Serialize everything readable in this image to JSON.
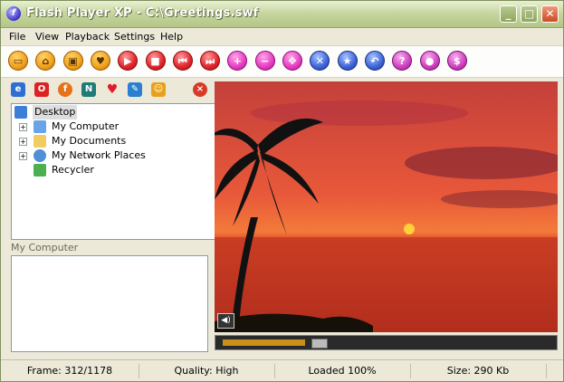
{
  "window": {
    "title": "Flash Player XP - C:\\Greetings.swf",
    "controls": {
      "minimize": "_",
      "maximize": "□",
      "close": "✕"
    }
  },
  "menu": [
    "File",
    "View",
    "Playback",
    "Settings",
    "Help"
  ],
  "toolbar": [
    {
      "name": "open-folder-icon",
      "glyph": "▭",
      "color": "orange"
    },
    {
      "name": "home-icon",
      "glyph": "⌂",
      "color": "orange"
    },
    {
      "name": "save-disk-icon",
      "glyph": "▣",
      "color": "orange"
    },
    {
      "name": "favorite-heart-icon",
      "glyph": "♥",
      "color": "orange"
    },
    {
      "name": "play-icon",
      "glyph": "▶",
      "color": "red"
    },
    {
      "name": "stop-icon",
      "glyph": "■",
      "color": "red"
    },
    {
      "name": "previous-frame-icon",
      "glyph": "⏮",
      "color": "red"
    },
    {
      "name": "next-frame-icon",
      "glyph": "⏭",
      "color": "red"
    },
    {
      "name": "zoom-in-icon",
      "glyph": "+",
      "color": "pink"
    },
    {
      "name": "zoom-out-icon",
      "glyph": "−",
      "color": "pink"
    },
    {
      "name": "fit-icon",
      "glyph": "✥",
      "color": "pink"
    },
    {
      "name": "tools-icon",
      "glyph": "✕",
      "color": "blue"
    },
    {
      "name": "star-icon",
      "glyph": "★",
      "color": "blue"
    },
    {
      "name": "back-arrow-icon",
      "glyph": "↶",
      "color": "blue"
    },
    {
      "name": "help-icon",
      "glyph": "?",
      "color": "magenta"
    },
    {
      "name": "user-icon",
      "glyph": "●",
      "color": "magenta"
    },
    {
      "name": "money-icon",
      "glyph": "$",
      "color": "magenta"
    }
  ],
  "sidebar": {
    "icons": [
      "internet-explorer-icon",
      "opera-icon",
      "firefox-icon",
      "netscape-icon",
      "favorites-heart-icon",
      "edit-icon",
      "swf-icon"
    ],
    "tree": [
      {
        "label": "Desktop",
        "level": 0,
        "icon": "desktop-icon"
      },
      {
        "label": "My Computer",
        "level": 1,
        "icon": "computer-icon",
        "expander": "+"
      },
      {
        "label": "My Documents",
        "level": 1,
        "icon": "documents-folder-icon",
        "expander": "+"
      },
      {
        "label": "My Network Places",
        "level": 1,
        "icon": "network-icon",
        "expander": "+"
      },
      {
        "label": "Recycler",
        "level": 1,
        "icon": "recycle-bin-icon"
      }
    ],
    "selected_label": "My Computer"
  },
  "player": {
    "progress_percent": 25,
    "thumb_percent": 27,
    "sound_label": "◀)"
  },
  "status": {
    "frame": "Frame: 312/1178",
    "quality": "Quality: High",
    "loaded": "Loaded 100%",
    "size": "Size: 290 Kb"
  },
  "colors": {
    "accent": "#b3c586",
    "sunset_sky": "#d84a2a",
    "sea": "#c13a22"
  }
}
